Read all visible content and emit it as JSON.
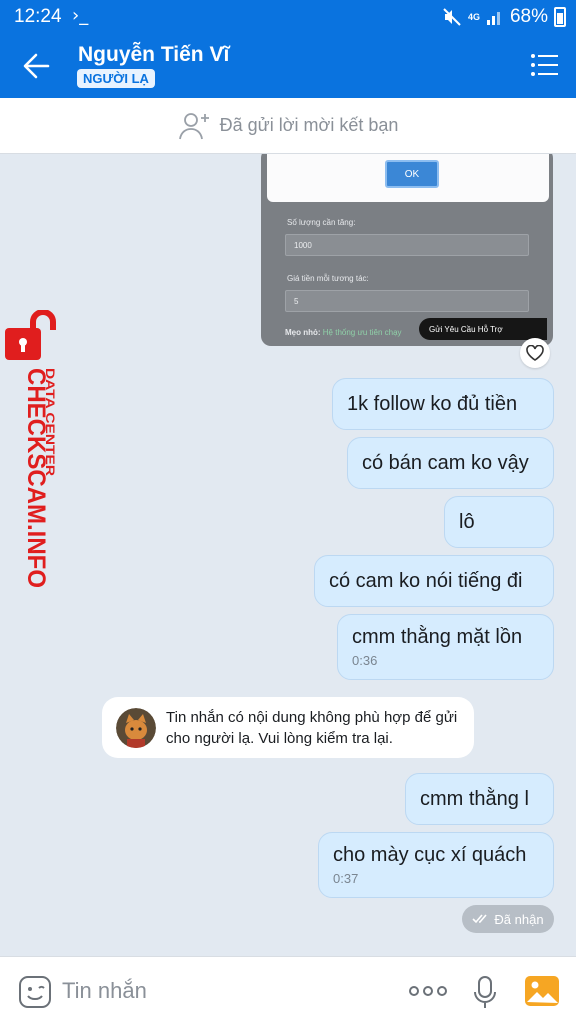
{
  "status_bar": {
    "time": "12:24",
    "network": "4G",
    "battery": "68%"
  },
  "header": {
    "contact_name": "Nguyễn Tiến Vĩ",
    "badge": "NGƯỜI LẠ"
  },
  "friend_request": {
    "text": "Đã gửi lời mời kết bạn"
  },
  "shared_image": {
    "ok_label": "OK",
    "quantity_label": "Số lượng cần tăng:",
    "quantity_value": "1000",
    "price_label": "Giá tiền mỗi tương tác:",
    "price_value": "5",
    "tip_prefix": "Mẹo nhỏ:",
    "tip_link": "Hệ thống ưu tiên chạy",
    "support_label": "Gửi Yêu Cầu Hỗ Trợ"
  },
  "messages": [
    {
      "text": "1k follow ko đủ tiền",
      "time": ""
    },
    {
      "text": "có bán cam ko vậy",
      "time": ""
    },
    {
      "text": "lô",
      "time": ""
    },
    {
      "text": "có cam ko nói tiếng đi",
      "time": ""
    },
    {
      "text": "cmm thằng mặt lồn",
      "time": "0:36"
    },
    {
      "text": "cmm thằng l",
      "time": ""
    },
    {
      "text": "cho mày cục xí quách",
      "time": "0:37"
    }
  ],
  "system_message": {
    "text": "Tin nhắn có nội dung không phù hợp để gửi cho người lạ. Vui lòng kiểm tra lại."
  },
  "delivery_status": "Đã nhận",
  "watermark": {
    "brand": "CHECKSCAM.INFO",
    "sub": "DATA CENTER"
  },
  "composer": {
    "placeholder": "Tin nhắn"
  },
  "colors": {
    "primary": "#0a73df",
    "bubble": "#d6ecfe",
    "watermark": "#e01e1e"
  }
}
